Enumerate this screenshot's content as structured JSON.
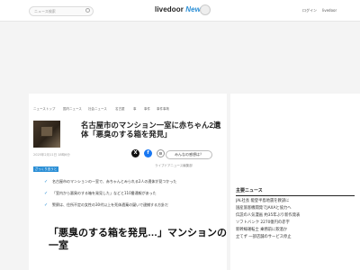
{
  "header": {
    "search_placeholder": "ニュース検索",
    "logo_main": "livedoor",
    "logo_news": "News",
    "login": "ログイン",
    "signup": "livedoor"
  },
  "breadcrumbs": [
    "ニューストップ",
    "国内ニュース",
    "社会ニュース",
    "名古屋",
    "事",
    "事件",
    "事件事故"
  ],
  "article": {
    "title": "名古屋市のマンション一室に赤ちゃん2遺体「悪臭のする箱を発見」",
    "date": "2025年2月11日 18時6分",
    "comment_button": "みんなの感想は？",
    "source": "ライブドアニュース編集部",
    "tag": "ざっくり言うと",
    "points": [
      "名古屋市のマンションの一室で、赤ちゃんとみられる2人の遺体が見つかった",
      "「室内から悪臭のする箱を発見した」などと110番通報があった",
      "警察は、住所不定の女性の30代以上を死体遺棄の疑いで逮捕する方針だ"
    ],
    "heading": "「悪臭のする箱を発見…」マンションの一室",
    "share_x": "X",
    "share_fb": "f",
    "share_link": "⊝"
  },
  "sidebar": {
    "title": "主要ニュース",
    "items": [
      "JAL社長 能登半島地震を教訓に",
      "国産旅客機開発でJAXAと協力へ",
      "伝説の人気漫画 約35年ぶり新作発表",
      "ソフトバンク 2270億円の赤字",
      "新幹線運転士 乗務前に飲酒か",
      "立てず 一部店舗のサービス停止"
    ]
  }
}
